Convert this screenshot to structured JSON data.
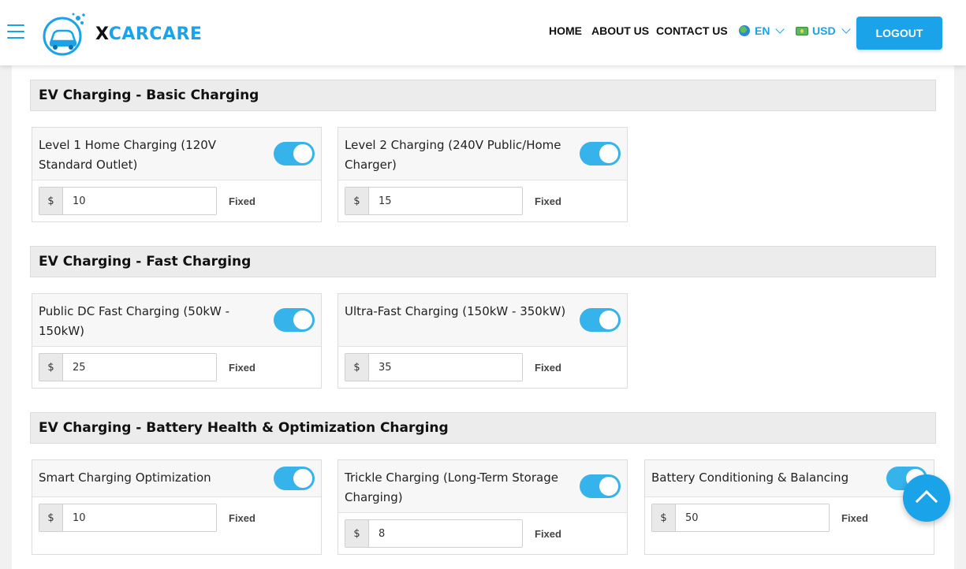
{
  "header": {
    "logo_letter": "X",
    "logo_rest": "CARCARE",
    "nav": [
      {
        "label": "HOME"
      },
      {
        "label": "ABOUT US"
      },
      {
        "label": "CONTACT US"
      }
    ],
    "language": "EN",
    "currency": "USD",
    "logout_label": "LOGOUT"
  },
  "currency_symbol": "$",
  "sections": [
    {
      "title": "EV Charging - Basic Charging",
      "services": [
        {
          "name": "Level 1 Home Charging (120V Standard Outlet)",
          "enabled": true,
          "price": "10",
          "type": "Fixed"
        },
        {
          "name": "Level 2 Charging (240V Public/Home Charger)",
          "enabled": true,
          "price": "15",
          "type": "Fixed"
        }
      ]
    },
    {
      "title": "EV Charging - Fast Charging",
      "services": [
        {
          "name": "Public DC Fast Charging (50kW - 150kW)",
          "enabled": true,
          "price": "25",
          "type": "Fixed"
        },
        {
          "name": "Ultra-Fast Charging (150kW - 350kW)",
          "enabled": true,
          "price": "35",
          "type": "Fixed"
        }
      ]
    },
    {
      "title": "EV Charging - Battery Health & Optimization Charging",
      "services": [
        {
          "name": "Smart Charging Optimization",
          "enabled": true,
          "price": "10",
          "type": "Fixed"
        },
        {
          "name": "Trickle Charging (Long-Term Storage Charging)",
          "enabled": true,
          "price": "8",
          "type": "Fixed"
        },
        {
          "name": "Battery Conditioning & Balancing",
          "enabled": true,
          "price": "50",
          "type": "Fixed"
        }
      ]
    }
  ],
  "colors": {
    "accent": "#1aa3e8",
    "toggle_on": "#35b3ea"
  },
  "icons": {
    "menu": "hamburger-icon",
    "scroll_top": "chevron-up-icon",
    "language": "globe-icon",
    "currency": "banknote-icon"
  }
}
